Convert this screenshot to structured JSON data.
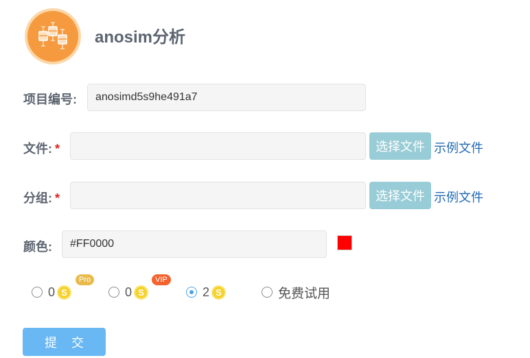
{
  "header": {
    "title": "anosim分析",
    "logo_icon": "boxplot-chart-icon"
  },
  "form": {
    "project_id": {
      "label": "项目编号:",
      "value": "anosimd5s9he491a7"
    },
    "file": {
      "label": "文件:",
      "required_mark": "*",
      "value": "",
      "choose_label": "选择文件",
      "example_label": "示例文件"
    },
    "group": {
      "label": "分组:",
      "required_mark": "*",
      "value": "",
      "choose_label": "选择文件",
      "example_label": "示例文件"
    },
    "color": {
      "label": "颜色:",
      "value": "#FF0000",
      "swatch_color": "#FF0000"
    }
  },
  "pricing": {
    "options": [
      {
        "amount": "0",
        "coin_icon": "coin-icon",
        "coin_symbol": "S",
        "tag": "Pro",
        "tag_color": "#e8bb4c",
        "selected": false
      },
      {
        "amount": "0",
        "coin_icon": "coin-icon",
        "coin_symbol": "S",
        "tag": "VIP",
        "tag_color": "#f4622d",
        "selected": false
      },
      {
        "amount": "2",
        "coin_icon": "coin-icon",
        "coin_symbol": "S",
        "tag": "",
        "selected": true
      },
      {
        "label": "免费试用",
        "selected": false
      }
    ]
  },
  "submit_label": "提 交"
}
